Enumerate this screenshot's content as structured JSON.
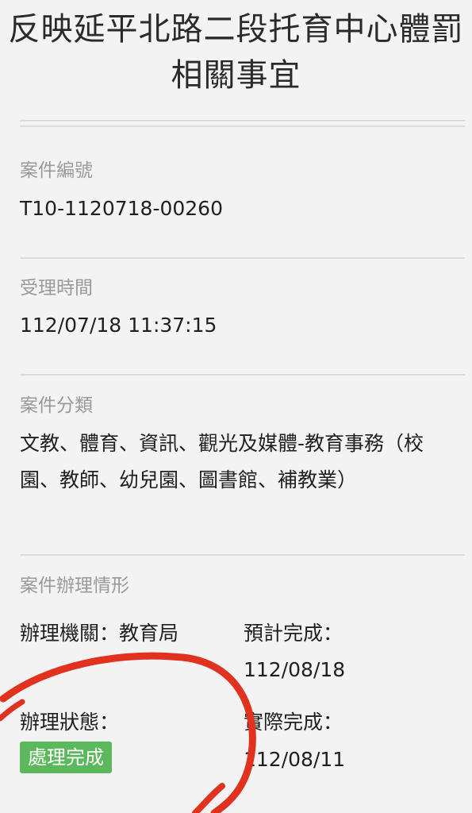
{
  "case": {
    "title": "反映延平北路二段托育中心體罰相關事宜",
    "number_label": "案件編號",
    "number_value": "T10-1120718-00260",
    "received_label": "受理時間",
    "received_value": "112/07/18 11:37:15",
    "category_label": "案件分類",
    "category_value": "文教、體育、資訊、觀光及媒體-教育事務（校園、教師、幼兒園、圖書館、補教業）",
    "handling_label": "案件辦理情形",
    "agency_text": "辦理機關：教育局",
    "expected_label": "預計完成：",
    "expected_value": "112/08/18",
    "status_label": "辦理狀態：",
    "status_value": "處理完成",
    "actual_label": "實際完成：",
    "actual_value": "112/08/11"
  },
  "colors": {
    "status_badge": "#5cb85c",
    "annotation_scribble": "#e0321e"
  }
}
